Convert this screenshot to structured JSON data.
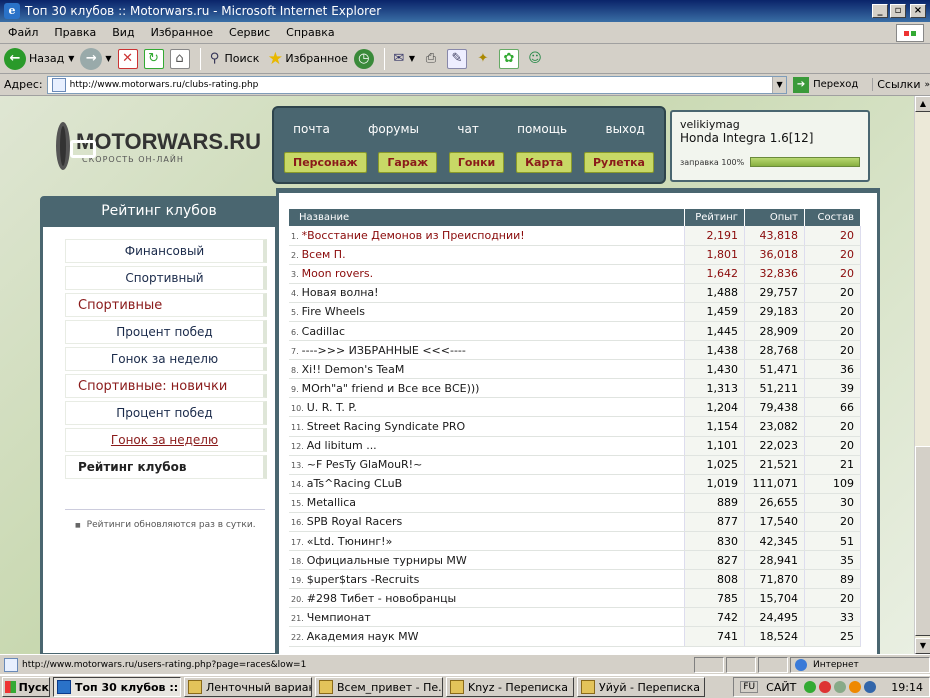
{
  "window": {
    "title": "Топ 30 клубов :: Motorwars.ru - Microsoft Internet Explorer"
  },
  "menu": [
    "Файл",
    "Правка",
    "Вид",
    "Избранное",
    "Сервис",
    "Справка"
  ],
  "toolbar": {
    "back_label": "Назад",
    "search_label": "Поиск",
    "favorites_label": "Избранное"
  },
  "address": {
    "label": "Адрес:",
    "url": "http://www.motorwars.ru/clubs-rating.php",
    "go_label": "Переход",
    "links_label": "Ссылки"
  },
  "site": {
    "logo_text": "MOTORWARS.RU",
    "slogan": "СКОРОСТЬ ОН-ЛАЙН",
    "top_links": [
      "почта",
      "форумы",
      "чат",
      "помощь",
      "выход"
    ],
    "nav_buttons": [
      "Персонаж",
      "Гараж",
      "Гонки",
      "Карта",
      "Рулетка"
    ],
    "user": {
      "name": "velikiymag",
      "car": "Honda Integra 1.6[12]",
      "fuel_label": "заправка 100%",
      "fuel_level": 1.0
    }
  },
  "left_panel": {
    "title": "Рейтинг клубов",
    "items": [
      {
        "label": "Финансовый",
        "kind": "sub"
      },
      {
        "label": "Спортивный",
        "kind": "sub"
      },
      {
        "label": "Спортивные",
        "kind": "cat"
      },
      {
        "label": "Процент побед",
        "kind": "sub"
      },
      {
        "label": "Гонок за неделю",
        "kind": "sub"
      },
      {
        "label": "Спортивные: новички",
        "kind": "cat"
      },
      {
        "label": "Процент побед",
        "kind": "sub"
      },
      {
        "label": "Гонок за неделю",
        "kind": "sub active"
      },
      {
        "label": "Рейтинг клубов",
        "kind": "bold"
      }
    ],
    "note": "Рейтинги обновляются раз в сутки."
  },
  "table": {
    "headers": {
      "name": "Название",
      "rating": "Рейтинг",
      "exp": "Опыт",
      "members": "Состав"
    },
    "rows": [
      {
        "idx": "1.",
        "name": "*Восстание Демонов из Преисподнии!",
        "rating": "2,191",
        "exp": "43,818",
        "members": "20",
        "top": true
      },
      {
        "idx": "2.",
        "name": "Всем П.",
        "rating": "1,801",
        "exp": "36,018",
        "members": "20",
        "top": true
      },
      {
        "idx": "3.",
        "name": "Moon rovers.",
        "rating": "1,642",
        "exp": "32,836",
        "members": "20",
        "top": true
      },
      {
        "idx": "4.",
        "name": "Новая волна!",
        "rating": "1,488",
        "exp": "29,757",
        "members": "20"
      },
      {
        "idx": "5.",
        "name": "Fire Wheels",
        "rating": "1,459",
        "exp": "29,183",
        "members": "20"
      },
      {
        "idx": "6.",
        "name": "Cadillac",
        "rating": "1,445",
        "exp": "28,909",
        "members": "20"
      },
      {
        "idx": "7.",
        "name": "---->>> ИЗБРАННЫЕ <<<----",
        "rating": "1,438",
        "exp": "28,768",
        "members": "20"
      },
      {
        "idx": "8.",
        "name": "Xi!! Demon's TeaM",
        "rating": "1,430",
        "exp": "51,471",
        "members": "36"
      },
      {
        "idx": "9.",
        "name": "MOrh\"a\" friend и Все все ВСЕ)))",
        "rating": "1,313",
        "exp": "51,211",
        "members": "39"
      },
      {
        "idx": "10.",
        "name": "U. R. T. P.",
        "rating": "1,204",
        "exp": "79,438",
        "members": "66"
      },
      {
        "idx": "11.",
        "name": "Street Racing Syndicate PRO",
        "rating": "1,154",
        "exp": "23,082",
        "members": "20"
      },
      {
        "idx": "12.",
        "name": "Ad libitum ...",
        "rating": "1,101",
        "exp": "22,023",
        "members": "20"
      },
      {
        "idx": "13.",
        "name": "~F PesTy GlaMouR!~",
        "rating": "1,025",
        "exp": "21,521",
        "members": "21"
      },
      {
        "idx": "14.",
        "name": "aTs^Racing CLuB",
        "rating": "1,019",
        "exp": "111,071",
        "members": "109"
      },
      {
        "idx": "15.",
        "name": "Metallica",
        "rating": "889",
        "exp": "26,655",
        "members": "30"
      },
      {
        "idx": "16.",
        "name": "SPB Royal Racers",
        "rating": "877",
        "exp": "17,540",
        "members": "20"
      },
      {
        "idx": "17.",
        "name": "«Ltd. Тюнинг!»",
        "rating": "830",
        "exp": "42,345",
        "members": "51"
      },
      {
        "idx": "18.",
        "name": "Официальные турниры MW",
        "rating": "827",
        "exp": "28,941",
        "members": "35"
      },
      {
        "idx": "19.",
        "name": "$uper$tars -Recruits",
        "rating": "808",
        "exp": "71,870",
        "members": "89"
      },
      {
        "idx": "20.",
        "name": "#298 Тибет - новобранцы",
        "rating": "785",
        "exp": "15,704",
        "members": "20"
      },
      {
        "idx": "21.",
        "name": "Чемпионат",
        "rating": "742",
        "exp": "24,495",
        "members": "33"
      },
      {
        "idx": "22.",
        "name": "Академия наук MW",
        "rating": "741",
        "exp": "18,524",
        "members": "25"
      }
    ]
  },
  "status": {
    "url": "http://www.motorwars.ru/users-rating.php?page=races&low=1",
    "zone": "Интернет"
  },
  "taskbar": {
    "start": "Пуск",
    "tasks": [
      {
        "label": "Топ 30 клубов :: M...",
        "active": true
      },
      {
        "label": "Ленточный вариан...",
        "active": false
      },
      {
        "label": "Всем_привет - Пе...",
        "active": false
      },
      {
        "label": "Knyz - Переписка",
        "active": false
      },
      {
        "label": "Уйуй - Переписка",
        "active": false
      }
    ],
    "lang": "FU",
    "tray_label": "САЙТ",
    "clock": "19:14"
  },
  "colors": {
    "accent": "#4a6670",
    "top_rank": "#8a0a0a",
    "nav_button": "#c8d866"
  }
}
